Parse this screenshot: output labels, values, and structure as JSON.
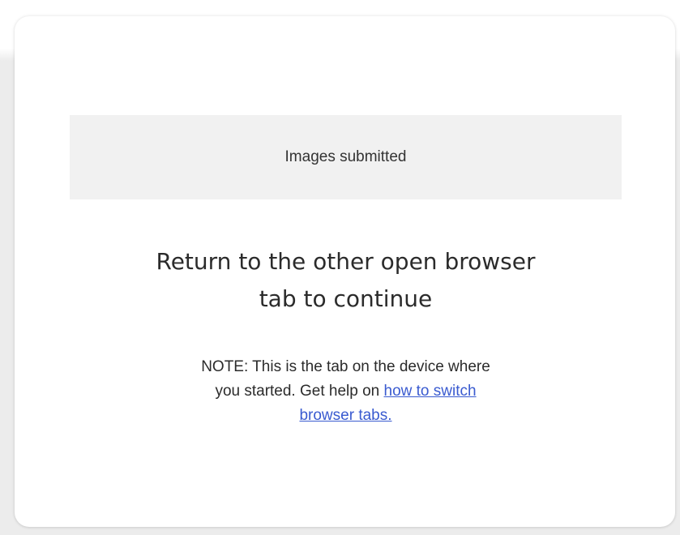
{
  "status": {
    "label": "Images submitted"
  },
  "headline": {
    "line1": "Return to the other open browser",
    "line2": "tab to continue"
  },
  "note": {
    "line1": "NOTE: This is the tab on the device where",
    "line2_prefix": "you started. Get help on ",
    "link_part1": "how to switch",
    "link_part2": "browser tabs."
  },
  "colors": {
    "link": "#3a5bd0",
    "text": "#2b2b2b",
    "banner_bg": "#f1f1f1"
  }
}
